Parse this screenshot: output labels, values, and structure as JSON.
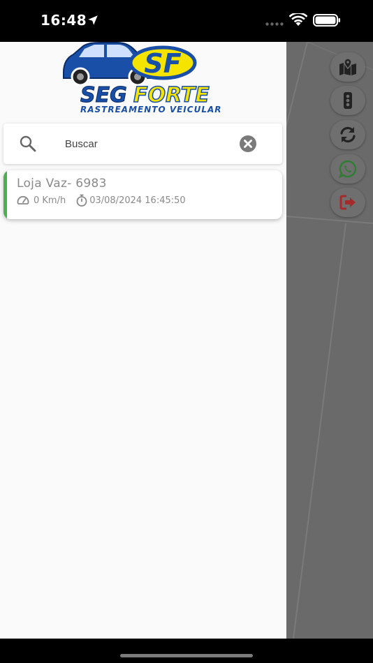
{
  "status_bar": {
    "time": "16:48"
  },
  "brand": {
    "monogram": "SF",
    "name_part1": "SEG",
    "name_part2": "FORTE",
    "tagline": "RASTREAMENTO VEICULAR"
  },
  "search": {
    "placeholder": "Buscar",
    "value": ""
  },
  "vehicles": [
    {
      "name": "Loja Vaz- 6983",
      "speed": "0 Km/h",
      "timestamp": "03/08/2024 16:45:50",
      "status_color": "#4caf50"
    }
  ],
  "actions": [
    {
      "icon": "map-marked-icon"
    },
    {
      "icon": "traffic-light-icon"
    },
    {
      "icon": "refresh-icon"
    },
    {
      "icon": "whatsapp-icon",
      "color": "#2e7d32"
    },
    {
      "icon": "logout-icon",
      "color": "#a52a2a"
    }
  ]
}
